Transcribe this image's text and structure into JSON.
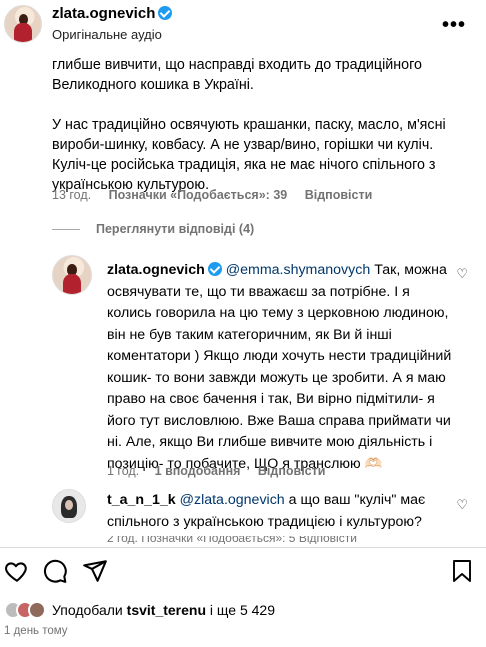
{
  "header": {
    "username": "zlata.ognevich",
    "subtitle": "Оригінальне аудіо",
    "more_icon": "more-horizontal-icon"
  },
  "comment": {
    "lines_p1": "глибше вивчити, що насправді входить до традиційного Великодного кошика в Україні.",
    "lines_p2": "У нас традиційно освячують крашанки, паску, масло, м'ясні вироби-шинку, ковбасу. А не узвар/вино, горішки чи куліч. Куліч-це російська традиція, яка не має нічого спільного з українською культурою.",
    "time": "13 год.",
    "likes": "Позначки «Подобається»: 39",
    "reply_label": "Відповісти"
  },
  "view_replies": "Переглянути відповіді (4)",
  "reply1": {
    "username": "zlata.ognevich",
    "mention": "@emma.shymanovych",
    "text": "Так, можна освячувати те, що ти вважаєш за потрібне. І я колись говорила на цю тему з церковною людиною, він не був таким категоричним, як Ви й інші коментатори ) Якщо люди хочуть нести традиційний кошик- то вони завжди можуть це зробити. А я маю право на своє бачення і так, Ви вірно підмітили- я його тут висловлюю. Вже Ваша справа приймати чи ні. Але, якщо Ви глибше вивчите мою діяльність і позицію- то побачите, ЩО я транслюю",
    "emoji": "🫶🏻",
    "likes": "1 вподобання",
    "reply_label": "Відповісти"
  },
  "reply2": {
    "username": "t_a_n_1_k",
    "mention": "@zlata.ognevich",
    "text": "а що ваш \"куліч\" має спільного з українською традицією і культурою?",
    "meta_cut": "2 год.   Позначки «Подобається»: 5   Відповісти"
  },
  "actions": {
    "like_icon": "heart-icon",
    "comment_icon": "comment-icon",
    "share_icon": "send-icon",
    "save_icon": "bookmark-icon"
  },
  "footer": {
    "liked_by_prefix": "Уподобали",
    "liked_by_user": "tsvit_terenu",
    "liked_by_suffix": "і ще 5 429",
    "time_ago": "1 день тому"
  }
}
